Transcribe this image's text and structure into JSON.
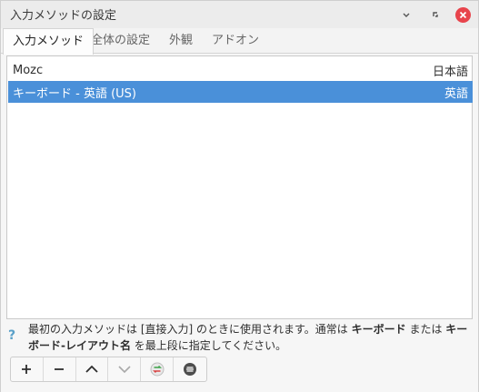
{
  "window": {
    "title": "入力メソッドの設定",
    "minimize_glyph": "⌄",
    "maximize_glyph": "⌃",
    "close_glyph": "✕"
  },
  "tabs": [
    {
      "label": "入力メソッド",
      "active": true
    },
    {
      "label": "全体の設定",
      "active": false
    },
    {
      "label": "外観",
      "active": false
    },
    {
      "label": "アドオン",
      "active": false
    }
  ],
  "input_methods": [
    {
      "name": "Mozc",
      "language": "日本語",
      "selected": false
    },
    {
      "name": "キーボード - 英語 (US)",
      "language": "英語",
      "selected": true
    }
  ],
  "help": {
    "icon": "?",
    "text_part1": "最初の入力メソッドは [直接入力] のときに使用されます。通常は ",
    "bold1": "キーボード",
    "text_part2": " または ",
    "bold2": "キーボード-レイアウト名",
    "text_part3": " を最上段に指定してください。"
  },
  "toolbar": {
    "add": "+",
    "remove": "−",
    "up": "︿",
    "down": "﹀",
    "configure_icon": "configure-icon",
    "settings_icon": "settings-icon"
  },
  "colors": {
    "selection": "#4a90d9",
    "close_button": "#e8444c"
  }
}
